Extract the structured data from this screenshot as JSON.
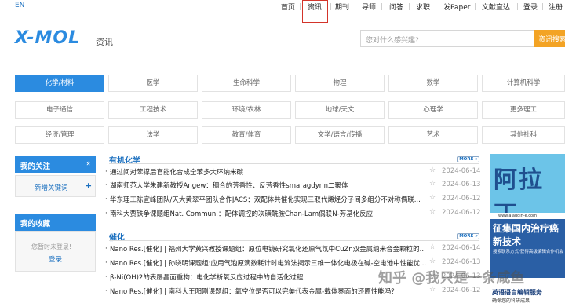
{
  "topnav": {
    "lang": "EN",
    "items": [
      "首页",
      "资讯",
      "期刊",
      "导师",
      "问答",
      "求职",
      "发Paper",
      "文献直达",
      "登录",
      "注册"
    ]
  },
  "header": {
    "logo": "X-MOL",
    "section": "资讯",
    "search_placeholder": "您对什么感兴趣?",
    "search_button": "资讯搜索"
  },
  "categories": [
    [
      "化学/材料",
      "医学",
      "生命科学",
      "物理",
      "数学",
      "计算机科学"
    ],
    [
      "电子通信",
      "工程技术",
      "环境/农林",
      "地球/天文",
      "心理学",
      "更多理工"
    ],
    [
      "经济/管理",
      "法学",
      "教育/体育",
      "文学/语言/传播",
      "艺术",
      "其他社科"
    ]
  ],
  "sidebar": {
    "follow_title": "我的关注",
    "follow_arrow": "«",
    "add_keyword": "新增关键词",
    "add_plus": "+",
    "collect_title": "我的收藏",
    "not_logged_in": "您暂时未登录!",
    "login": "登录"
  },
  "sections": [
    {
      "title": "有机化学",
      "more": "MORE »",
      "items": [
        {
          "title": "通过间对苯撑后官能化合成全苯多大环纳米碳",
          "date": "2024-06-14"
        },
        {
          "title": "湖南师范大学朱建新教授Angew：稠合的芳香性、反芳香性smaragdyrin二聚体",
          "date": "2024-06-13"
        },
        {
          "title": "华东理工陈宜峰团队/天大黄翠平团队合作JACS：双配体共催化实现三取代烯烃分子间多组分不对称偶联...",
          "date": "2024-06-12"
        },
        {
          "title": "南科大贾铁争课题组Nat. Commun.：配体调控的次磺酰胺Chan-Lam偶联N-芳基化反应",
          "date": "2024-06-12"
        }
      ]
    },
    {
      "title": "催化",
      "more": "MORE »",
      "items": [
        {
          "title": "Nano Res.[催化] | 福州大学黄兴教授课题组：原位电镜研究氧化还原气氛中CuZn双金属纳米合金颗粒的...",
          "date": "2024-06-14"
        },
        {
          "title": "Nano Res.[催化] | 孙晓明课题组:应用气泡原滴数耗计时电流法揭示三维一体化电极在碱-空电池中性能优...",
          "date": "2024-06-13"
        },
        {
          "title": "β-Ni(OH)2的表层晶面重构：电化学析氧反应过程中的自活化过程",
          "date": "2024-06-13"
        },
        {
          "title": "Nano Res.[催化] | 南科大王阳刚课题组：氧空位是否可以完美代表金属-载体界面的还原性能吗？",
          "date": "2024-06-12"
        }
      ]
    }
  ],
  "ad": {
    "top": "阿拉丁",
    "top_url": "www.aladdin-e.com",
    "mid1": "征集国内治疗癌",
    "mid2": "新技术",
    "mid3": "搜索联系方式/获得高级编辑合作机会",
    "bottom": "英语语言编辑服务",
    "bottom_sub": "确保您的科研成果"
  },
  "watermark": "知乎 @我只是一条咸鱼"
}
